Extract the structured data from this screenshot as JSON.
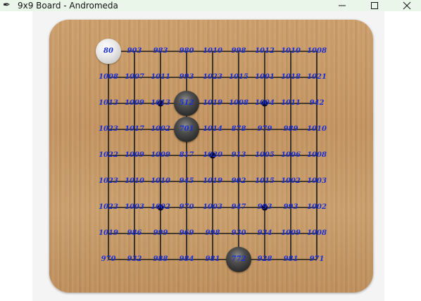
{
  "window": {
    "title": "9x9 Board - Andromeda",
    "app_icon": "feather-icon",
    "minimize_icon": "minimize-icon",
    "maximize_icon": "maximize-icon",
    "close_icon": "close-icon"
  },
  "board": {
    "size": 9,
    "line_color": "#1b1b1b",
    "label_color": "#1a2fd6",
    "star_points": [
      [
        2,
        2
      ],
      [
        6,
        2
      ],
      [
        4,
        4
      ],
      [
        2,
        6
      ],
      [
        6,
        6
      ]
    ],
    "stones": [
      {
        "color": "white",
        "col": 0,
        "row": 0
      },
      {
        "color": "black",
        "col": 3,
        "row": 2
      },
      {
        "color": "black",
        "col": 3,
        "row": 3
      },
      {
        "color": "black",
        "col": 5,
        "row": 8
      }
    ],
    "labels": [
      [
        "80",
        "903",
        "983",
        "980",
        "1010",
        "998",
        "1012",
        "1010",
        "1008"
      ],
      [
        "1008",
        "1007",
        "1011",
        "993",
        "1023",
        "1015",
        "1001",
        "1018",
        "1021"
      ],
      [
        "1013",
        "1009",
        "1013",
        "512",
        "1019",
        "1008",
        "1004",
        "1011",
        "942"
      ],
      [
        "1023",
        "1017",
        "1002",
        "701",
        "1014",
        "878",
        "979",
        "989",
        "1010"
      ],
      [
        "1022",
        "1009",
        "1009",
        "817",
        "1020",
        "913",
        "1005",
        "1006",
        "1008"
      ],
      [
        "1023",
        "1010",
        "1010",
        "945",
        "1019",
        "902",
        "1015",
        "1002",
        "1003"
      ],
      [
        "1023",
        "1003",
        "1002",
        "970",
        "1003",
        "947",
        "993",
        "993",
        "1002"
      ],
      [
        "1019",
        "986",
        "999",
        "969",
        "998",
        "930",
        "934",
        "1009",
        "1008"
      ],
      [
        "970",
        "932",
        "988",
        "984",
        "981",
        "772",
        "928",
        "981",
        "971"
      ]
    ]
  }
}
